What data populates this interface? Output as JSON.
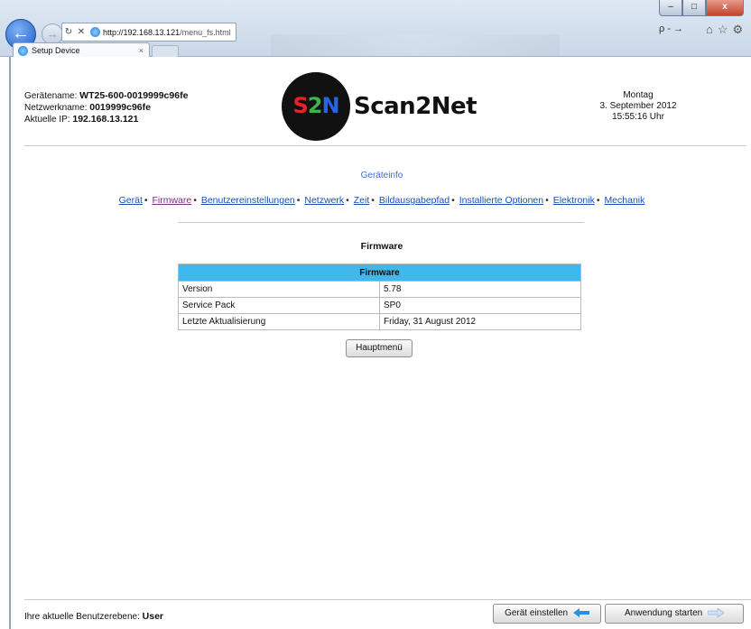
{
  "browser": {
    "url_host": "http://192.168.13.121",
    "url_path": "/menu_fs.html",
    "tab_title": "Setup Device",
    "tab_close": "×",
    "search_label": "ρ - →",
    "window_min": "–",
    "window_max": "□",
    "window_close": "x"
  },
  "device": {
    "name_label": "Gerätename:",
    "name": "WT25-600-0019999c96fe",
    "netname_label": "Netzwerkname:",
    "netname": "0019999c96fe",
    "ip_label": "Aktuelle IP:",
    "ip": "192.168.13.121"
  },
  "logo": {
    "mark": "S2N",
    "word": "Scan2Net"
  },
  "datetime": {
    "weekday": "Montag",
    "date": "3. September 2012",
    "time": "15:55:16 Uhr"
  },
  "page": {
    "title": "Geräteinfo",
    "section_title": "Firmware"
  },
  "menu": [
    {
      "label": "Gerät"
    },
    {
      "label": "Firmware",
      "active": true
    },
    {
      "label": "Benutzereinstellungen"
    },
    {
      "label": "Netzwerk"
    },
    {
      "label": "Zeit"
    },
    {
      "label": "Bildausgabepfad"
    },
    {
      "label": "Installierte Optionen"
    },
    {
      "label": "Elektronik"
    },
    {
      "label": "Mechanik"
    }
  ],
  "menu_separator": "•",
  "table": {
    "header": "Firmware",
    "rows": [
      {
        "key": "Version",
        "value": "5.78"
      },
      {
        "key": "Service Pack",
        "value": "SP0"
      },
      {
        "key": "Letzte Aktualisierung",
        "value": "Friday, 31 August 2012"
      }
    ]
  },
  "buttons": {
    "main_menu": "Hauptmenü",
    "setup_device": "Gerät einstellen",
    "start_app": "Anwendung starten"
  },
  "footer": {
    "user_level_label": "Ihre aktuelle Benutzerebene:",
    "user_level": "User"
  },
  "colors": {
    "table_header": "#3fb8f0",
    "link": "#1b4fb0",
    "visited_link": "#7a2e7e",
    "title_blue": "#3b6fd1"
  }
}
